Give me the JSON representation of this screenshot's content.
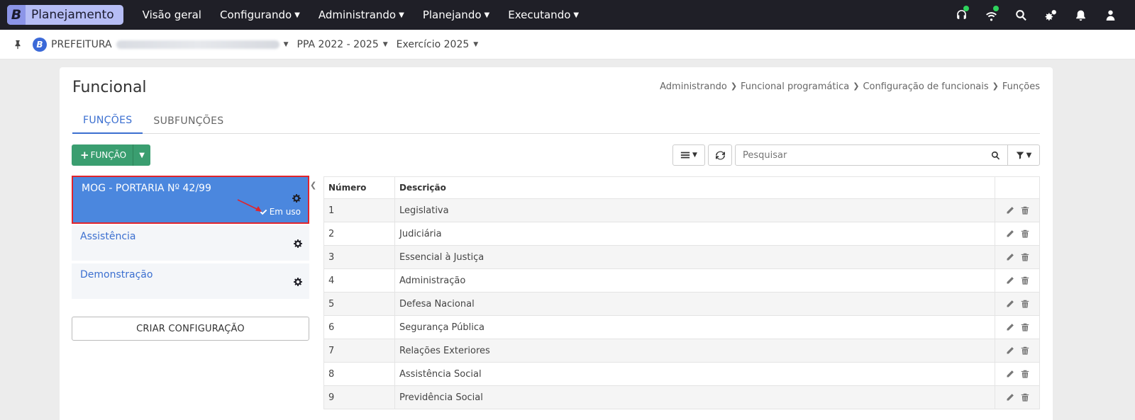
{
  "topbar": {
    "brand_letter": "B",
    "brand_name": "Planejamento",
    "nav": [
      {
        "label": "Visão geral",
        "dropdown": false
      },
      {
        "label": "Configurando",
        "dropdown": true
      },
      {
        "label": "Administrando",
        "dropdown": true
      },
      {
        "label": "Planejando",
        "dropdown": true
      },
      {
        "label": "Executando",
        "dropdown": true
      }
    ],
    "icons": [
      "headset-icon",
      "wifi-icon",
      "search-icon",
      "gears-icon",
      "bell-icon",
      "user-icon"
    ],
    "status_color": "#2ed35c"
  },
  "context": {
    "org_letter": "B",
    "org_label": "PREFEITURA",
    "ppa": "PPA 2022 - 2025",
    "exercicio": "Exercício 2025"
  },
  "page": {
    "title": "Funcional",
    "breadcrumb": [
      "Administrando",
      "Funcional programática",
      "Configuração de funcionais",
      "Funções"
    ],
    "tabs": [
      {
        "label": "FUNÇÕES",
        "active": true
      },
      {
        "label": "SUBFUNÇÕES",
        "active": false
      }
    ]
  },
  "toolbar": {
    "add_label": "FUNÇÃO",
    "search_placeholder": "Pesquisar"
  },
  "configs": [
    {
      "name": "MOG - PORTARIA Nº 42/99",
      "active": true,
      "status": "Em uso"
    },
    {
      "name": "Assistência",
      "active": false
    },
    {
      "name": "Demonstração",
      "active": false
    }
  ],
  "create_config_label": "CRIAR CONFIGURAÇÃO",
  "table": {
    "headers": [
      "Número",
      "Descrição",
      ""
    ],
    "rows": [
      {
        "numero": "1",
        "descricao": "Legislativa"
      },
      {
        "numero": "2",
        "descricao": "Judiciária"
      },
      {
        "numero": "3",
        "descricao": "Essencial à Justiça"
      },
      {
        "numero": "4",
        "descricao": "Administração"
      },
      {
        "numero": "5",
        "descricao": "Defesa Nacional"
      },
      {
        "numero": "6",
        "descricao": "Segurança Pública"
      },
      {
        "numero": "7",
        "descricao": "Relações Exteriores"
      },
      {
        "numero": "8",
        "descricao": "Assistência Social"
      },
      {
        "numero": "9",
        "descricao": "Previdência Social"
      }
    ]
  },
  "colors": {
    "topbar": "#1f1f27",
    "accent": "#3b6fd0",
    "success": "#3a9e70",
    "active_config": "#4b87de",
    "highlight_border": "#e0242c"
  }
}
